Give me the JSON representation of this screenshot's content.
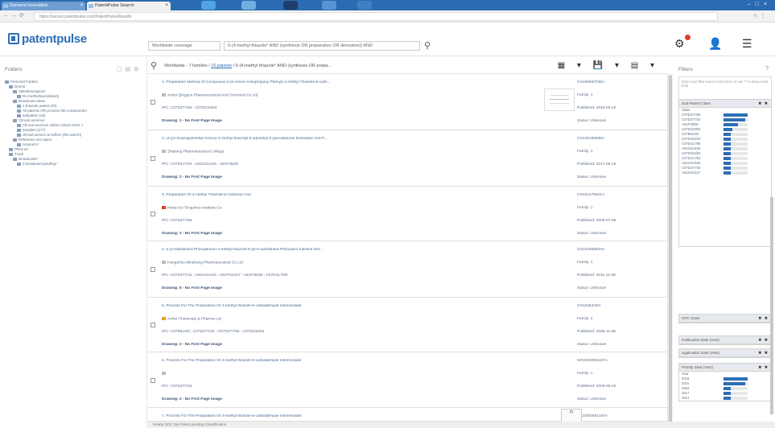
{
  "browser": {
    "tabs": [
      {
        "label": "Derwent Innovation",
        "active": false
      },
      {
        "label": "PatentPulse Search",
        "active": true
      }
    ],
    "address": "https://secure.patentpulse.com/PatentPulse/Results"
  },
  "app": {
    "logo": "patentpulse",
    "scope": "Worldwide coverage",
    "query": "5-(4-methyl thiazole* AND (synthesis OR preparation OR derivative)) AND",
    "breadcrumb_prefix": "Worldwide - 7 families /",
    "breadcrumb_link": "10 patents",
    "breadcrumb_query": "/ 5-(4-methyl thiazole* AND (synthesis OR prepa..."
  },
  "folders": {
    "title": "Folders",
    "items": [
      {
        "label": "Personal Folders",
        "level": 0
      },
      {
        "label": "Drums",
        "level": 1
      },
      {
        "label": "Valentinesspicen",
        "level": 2
      },
      {
        "label": "Ro-methythiazole(text)",
        "level": 3
      },
      {
        "label": "Broadcast views",
        "level": 2
      },
      {
        "label": "4-thiazole patent (20)",
        "level": 3
      },
      {
        "label": "All patents OR process (58 compounds)",
        "level": 3
      },
      {
        "label": "antipathic (18)",
        "level": 3
      },
      {
        "label": "Clinical services",
        "level": 2
      },
      {
        "label": "Clinical services selfors (2015-2016..)",
        "level": 3
      },
      {
        "label": "samples (177)",
        "level": 3
      },
      {
        "label": "clinical service at selfom (file search)",
        "level": 3
      },
      {
        "label": "Reference set cases",
        "level": 2
      },
      {
        "label": "Antonio's*",
        "level": 3
      },
      {
        "label": "PRIV-42",
        "level": 1
      },
      {
        "label": "Trash",
        "level": 1
      },
      {
        "label": "Broadcasts*",
        "level": 2
      },
      {
        "label": "4-broadcast pending*",
        "level": 3
      }
    ]
  },
  "results": [
    {
      "title": "1. Preparation Method Of Compound 2-(3-Amino-4-Isopropoxy Phenyl)-4-methyl Thiazole-5-carb...",
      "assignee": "Anhui Qingyun Pharmaceutical And Chemical Co Ltd",
      "ipc": "IPC: C07D277/56 ; C07D233/64",
      "drawing": "Drawing: 1 - No First Page Image",
      "pubno": "CN105693766A",
      "family": "Family: 1",
      "published": "Published: 2016-06-22",
      "status": "Status: Unknown",
      "flag_color": "#bbbbbb",
      "has_thumb": true
    },
    {
      "title": "2. (4-[(2-Isopropylmethyl Amino)-4-methyl-thiazolyl-5-yl]methyl-2-pyrrolidinone Derivative And P...",
      "assignee": "Zhejiang Pharmaceutical College",
      "ipc": "IPC: C07D417/04 ; A61K31/426 ; A61P35/00",
      "drawing": "Drawing: 2 - No First Page Image",
      "pubno": "CN106188899A",
      "family": "Family: 1",
      "published": "Published: 2017-06-16",
      "status": "Status: Unknown",
      "flag_color": "#bbbbbb",
      "has_thumb": false
    },
    {
      "title": "3. Preparation Of 4-methyl Thiazole-5-Carboxyl Acid",
      "assignee": "Hebei Ke Tengzhou Institute Co",
      "ipc": "IPC: C07D277/56",
      "drawing": "Drawing: 3 - No First Page Image",
      "pubno": "CN101475641A",
      "family": "Family: 1",
      "published": "Published: 2009-07-08",
      "status": "Status: Unknown",
      "flag_color": "#d9402b",
      "has_thumb": false
    },
    {
      "title": "4. 5-(2-substituted Phenylamino-4-methyl thiazole-5-yl)-5-substituted Phenylazo Indoline Der...",
      "assignee": "Hangzhou Minsheng Pharmaceutical Co Ltd",
      "ipc": "IPC: C07D277/42 ; A61K31/425 ; A61P31/427 ; A61P35/00 ; C07D417/06",
      "drawing": "Drawing: 5 - No First Page Image",
      "pubno": "CN101955804A",
      "family": "Family: 1",
      "published": "Published: 2011-12-08",
      "status": "Status: Unknown",
      "flag_color": "#bbbbbb",
      "has_thumb": false
    },
    {
      "title": "5. Process For The Preparation Of 4-methyl thiazole-5-carbaldehyde Intermediate",
      "assignee": "Anhui Chemicals & Pharma Ltd",
      "ipc": "IPC: C07B61/00 ; C07D277/24 ; C07D277/56 ; C07D233/24",
      "drawing": "Drawing: 2 - No First Page Image",
      "pubno": "CN1845443H",
      "family": "Family: 2",
      "published": "Published: 2005-11-05",
      "status": "Status: Unknown",
      "flag_color": "#e7a12d",
      "has_thumb": false
    },
    {
      "title": "6. Process For The Preparation Of 4-methyl thiazole-5-carbaldehyde Intermediate",
      "assignee": "",
      "ipc": "IPC: C07D277/24",
      "drawing": "Drawing: 2 - No First Page Image",
      "pubno": "WO2003091187A",
      "family": "Family: 1",
      "published": "Published: 2006-02-23",
      "status": "Status: Unknown",
      "flag_color": "#bbbbbb",
      "has_thumb": false
    },
    {
      "title": "7. Process For The Preparation Of 4-methyl thiazole-5-carbaldehyde Intermediate",
      "assignee": "",
      "ipc": "",
      "drawing": "",
      "pubno": "WO2003091187A",
      "family": "",
      "published": "",
      "status": "",
      "flag_color": "#bbbbbb",
      "has_thumb": false
    }
  ],
  "status_bar": "Ready (3/3)    Top   Patent pending   Classification",
  "filters": {
    "title": "Filters",
    "help": "?",
    "input_placeholder": "Enter your filter search terms here or use '?' to show more help",
    "buttons": [
      "Apply",
      "Clear",
      "Save"
    ],
    "ipc_box": {
      "title": "Sub-Patent Class",
      "sub": "Value",
      "rows": [
        {
          "label": "C07D277/56",
          "frac": 1.0
        },
        {
          "label": "C07D277/24",
          "frac": 0.9
        },
        {
          "label": "A61P35/00",
          "frac": 0.6
        },
        {
          "label": "C07D233/64",
          "frac": 0.35
        },
        {
          "label": "C07B61/00",
          "frac": 0.3
        },
        {
          "label": "C07D233/24",
          "frac": 0.3
        },
        {
          "label": "C07D417/06",
          "frac": 0.3
        },
        {
          "label": "A61K31/426",
          "frac": 0.3
        },
        {
          "label": "C07D233/54",
          "frac": 0.3
        },
        {
          "label": "C07D417/04",
          "frac": 0.3
        },
        {
          "label": "A61K31/425",
          "frac": 0.3
        },
        {
          "label": "C07D277/42",
          "frac": 0.3
        },
        {
          "label": "A61K31/427",
          "frac": 0.3
        }
      ]
    },
    "collapsed_boxes": [
      "CPC Class",
      "Publication Date (Year)",
      "Application Date (Year)"
    ],
    "priority_box": {
      "title": "Priority Date (Year)",
      "sub": "Year",
      "rows": [
        {
          "label": "2016",
          "frac": 1.0
        },
        {
          "label": "2015",
          "frac": 0.9
        },
        {
          "label": "2004",
          "frac": 0.3
        },
        {
          "label": "2017",
          "frac": 0.3
        },
        {
          "label": "2013",
          "frac": 0.3
        }
      ]
    }
  },
  "colors": {
    "brand": "#2c6fb6",
    "bar": "#2e6db4",
    "browser_tabbar": "#2a6bb3"
  }
}
